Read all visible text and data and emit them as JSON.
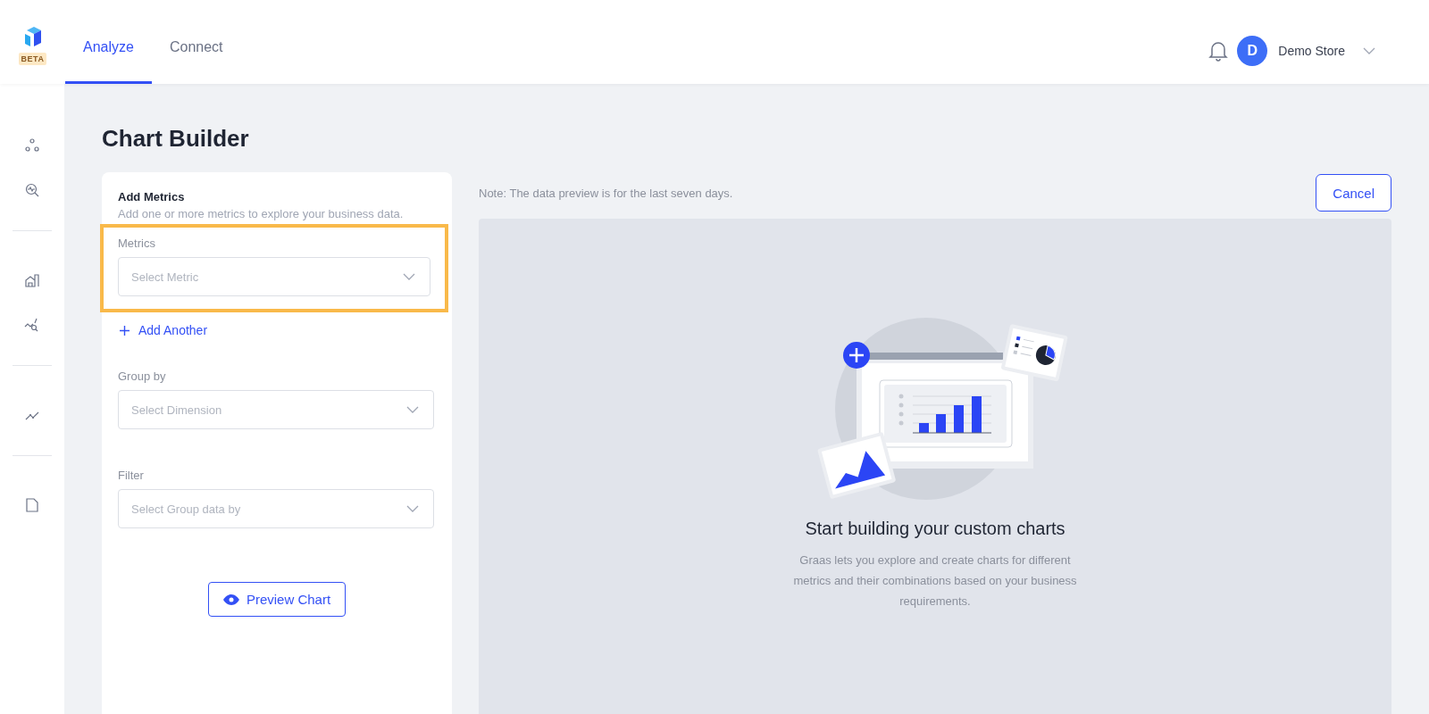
{
  "header": {
    "logo_badge": "BETA",
    "tabs": [
      {
        "label": "Analyze",
        "selected": true
      },
      {
        "label": "Connect",
        "selected": false
      }
    ],
    "user": {
      "avatar_initial": "D",
      "name": "Demo Store"
    }
  },
  "page": {
    "title": "Chart Builder"
  },
  "builder": {
    "heading": "Add Metrics",
    "subheading": "Add one or more metrics to explore your business data.",
    "fields": [
      {
        "label": "Metrics",
        "placeholder": "Select Metric",
        "highlighted": true,
        "add_link": "Add Another"
      },
      {
        "label": "Group by",
        "placeholder": "Select Dimension",
        "highlighted": false
      },
      {
        "label": "Filter",
        "placeholder": "Select Group data by",
        "highlighted": false
      }
    ],
    "preview_button": "Preview Chart"
  },
  "preview": {
    "note": "Note: The data preview is for the last seven days.",
    "cancel_button": "Cancel",
    "empty_title": "Start building your custom charts",
    "empty_text": "Graas lets you explore and create charts for different metrics and their combinations based on your business requirements."
  }
}
